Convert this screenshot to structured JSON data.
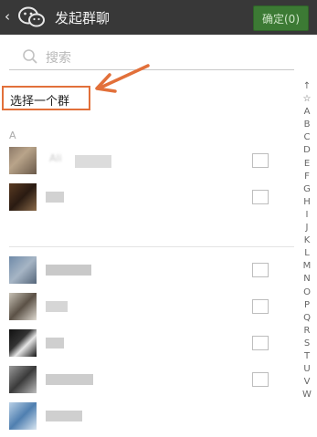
{
  "header": {
    "back_glyph": "‹",
    "title": "发起群聊",
    "confirm_label": "确定(0)"
  },
  "search": {
    "placeholder": "搜索"
  },
  "choose_group_label": "选择一个群",
  "section_letter": "A",
  "contacts": [
    {
      "name": "Ali"
    },
    {
      "name": ""
    },
    {
      "name": ""
    },
    {
      "name": ""
    },
    {
      "name": ""
    },
    {
      "name": ""
    },
    {
      "name": ""
    }
  ],
  "index_letters": [
    "↑",
    "☆",
    "A",
    "B",
    "C",
    "D",
    "E",
    "F",
    "G",
    "H",
    "I",
    "J",
    "K",
    "L",
    "M",
    "N",
    "O",
    "P",
    "Q",
    "R",
    "S",
    "T",
    "U",
    "V",
    "W"
  ],
  "colors": {
    "topbar": "#383838",
    "confirm": "#3c7a34",
    "highlight": "#e2703a"
  },
  "icons": {
    "logo": "wechat-logo-icon",
    "search": "search-icon",
    "arrow": "pointer-arrow-icon"
  }
}
